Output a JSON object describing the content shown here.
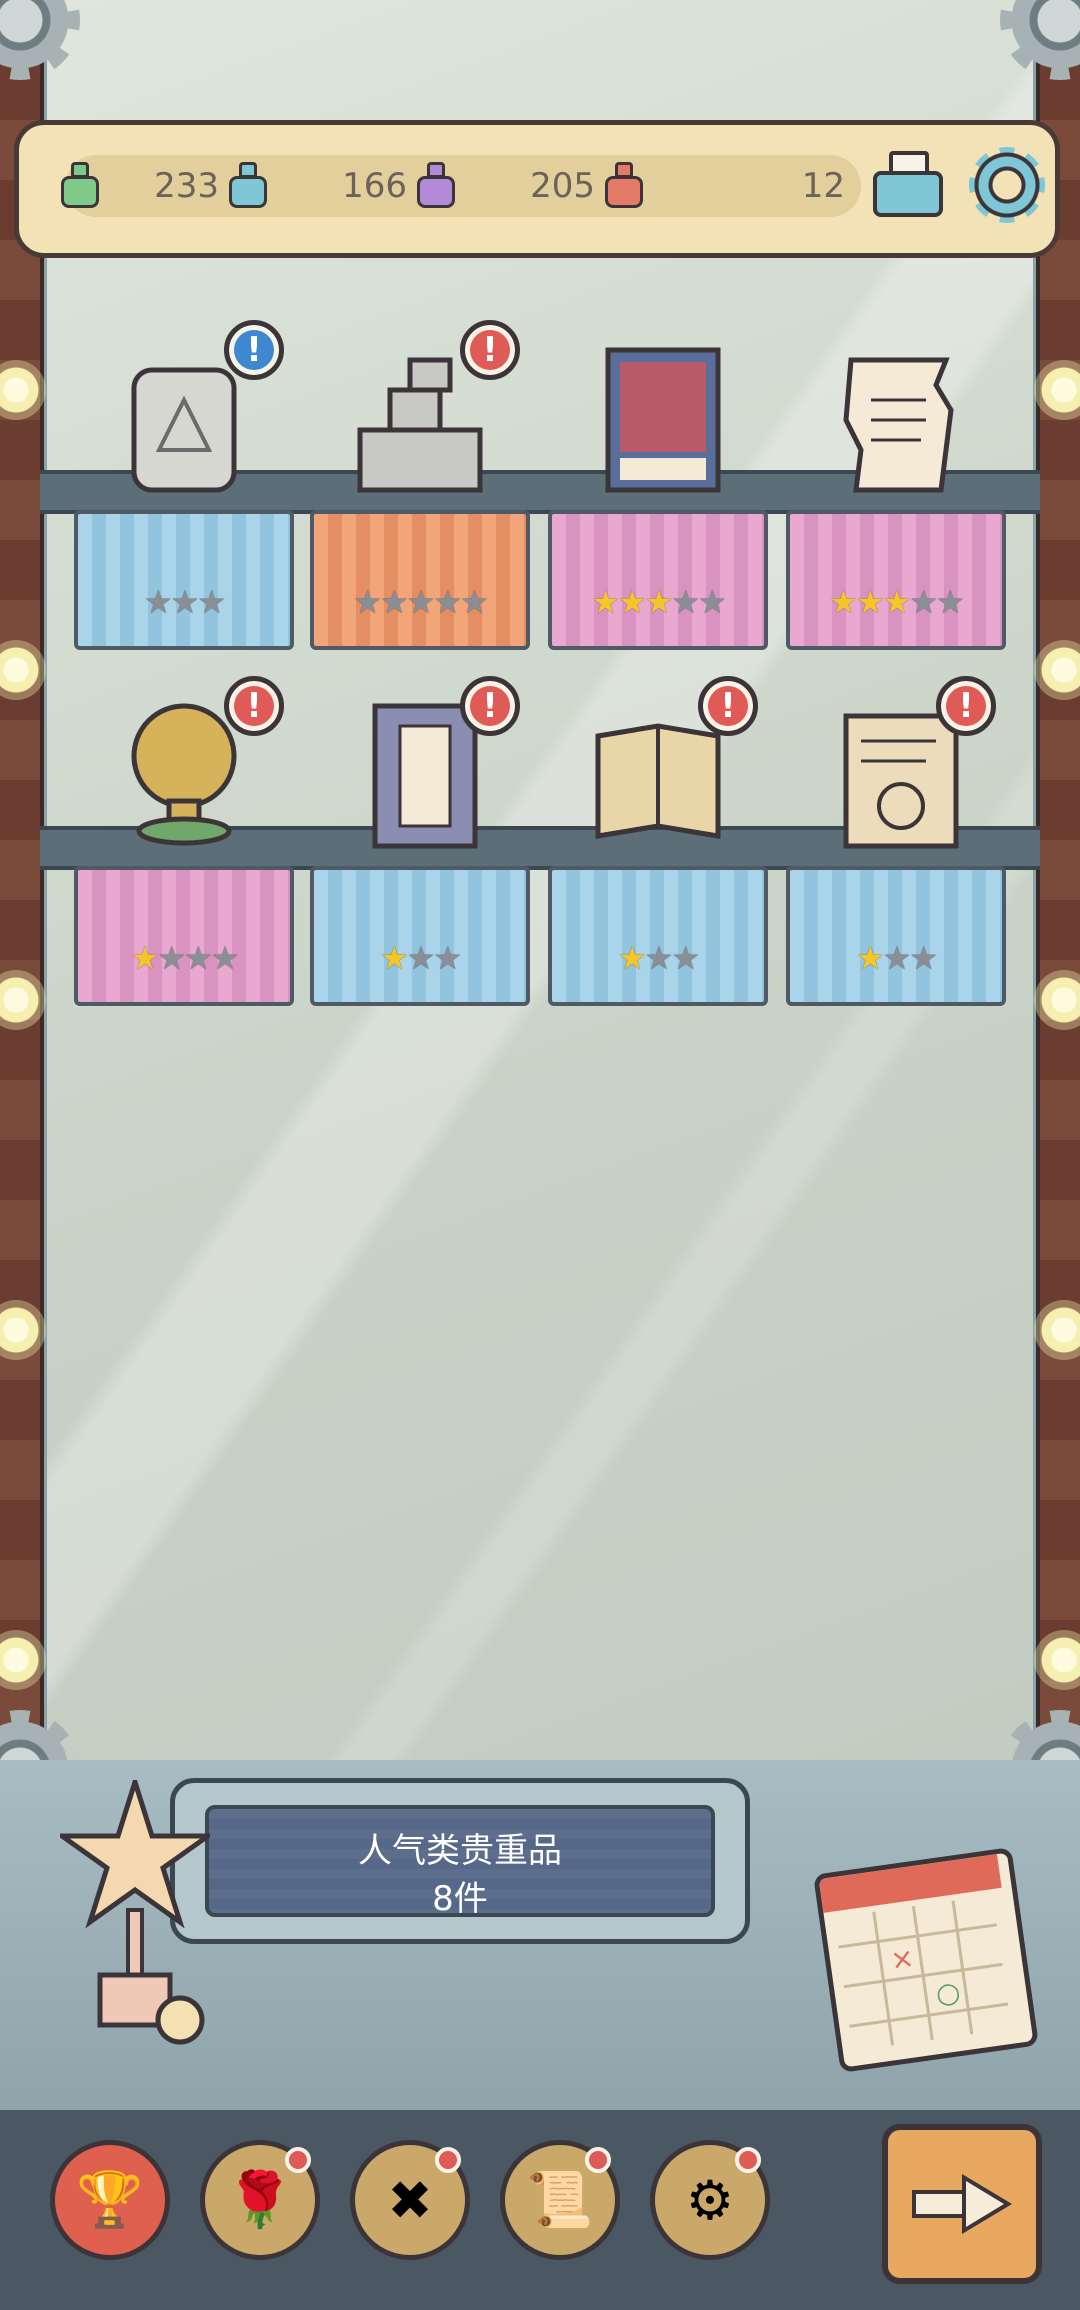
{
  "resources": [
    {
      "name": "ink-jar-green",
      "value": "233",
      "color": "#7fc98a"
    },
    {
      "name": "ink-jar-blue",
      "value": "166",
      "color": "#7fc7d6"
    },
    {
      "name": "ink-jar-purple",
      "value": "205",
      "color": "#b48ad8"
    },
    {
      "name": "ink-jar-red",
      "value": "12",
      "color": "#e47a6a"
    }
  ],
  "icons": {
    "mail": "envelope-letter-icon",
    "settings": "gear-icon",
    "next": "arrow-right-icon"
  },
  "shelves": [
    [
      {
        "item": "stone-tablet-icon",
        "cloth": "blue",
        "stars": 3,
        "filled": 0,
        "badge": "blue",
        "badge_text": "!"
      },
      {
        "item": "stone-blocks-icon",
        "cloth": "orange",
        "stars": 5,
        "filled": 0,
        "badge": "red",
        "badge_text": "!"
      },
      {
        "item": "painted-book-icon",
        "cloth": "pink",
        "stars": 5,
        "filled": 3,
        "badge": null,
        "badge_text": ""
      },
      {
        "item": "torn-scroll-icon",
        "cloth": "pink",
        "stars": 5,
        "filled": 3,
        "badge": null,
        "badge_text": ""
      }
    ],
    [
      {
        "item": "golden-globe-trophy-icon",
        "cloth": "pink",
        "stars": 4,
        "filled": 1,
        "badge": "red",
        "badge_text": "!"
      },
      {
        "item": "dictionary-book-icon",
        "cloth": "blue",
        "stars": 3,
        "filled": 1,
        "badge": "red",
        "badge_text": "!"
      },
      {
        "item": "open-ancient-book-icon",
        "cloth": "blue",
        "stars": 3,
        "filled": 1,
        "badge": "red",
        "badge_text": "!"
      },
      {
        "item": "sealed-document-icon",
        "cloth": "blue",
        "stars": 3,
        "filled": 1,
        "badge": "red",
        "badge_text": "!"
      }
    ]
  ],
  "plaque": {
    "title": "人气类贵重品",
    "count": "8件"
  },
  "nav": [
    {
      "name": "trophy-tab-icon",
      "glyph": "🏆",
      "active": true,
      "dot": false
    },
    {
      "name": "rose-tab-icon",
      "glyph": "🌹",
      "active": false,
      "dot": true
    },
    {
      "name": "tools-tab-icon",
      "glyph": "✖",
      "active": false,
      "dot": true
    },
    {
      "name": "scroll-tab-icon",
      "glyph": "📜",
      "active": false,
      "dot": true
    },
    {
      "name": "gear-tab-icon",
      "glyph": "⚙",
      "active": false,
      "dot": true
    }
  ]
}
